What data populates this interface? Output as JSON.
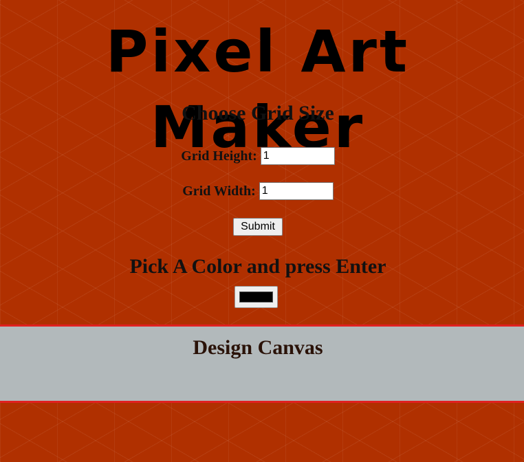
{
  "header": {
    "title": "Pixel Art Maker"
  },
  "grid_form": {
    "heading": "Choose Grid Size",
    "height_label": "Grid Height:",
    "height_value": "1",
    "width_label": "Grid Width:",
    "width_value": "1",
    "submit_label": "Submit"
  },
  "color_section": {
    "heading": "Pick A Color and press Enter",
    "selected_color": "#000000"
  },
  "canvas": {
    "heading": "Design Canvas"
  },
  "colors": {
    "background": "#b03000",
    "canvas_band": "#b2b9bb",
    "canvas_border": "#e02020"
  }
}
